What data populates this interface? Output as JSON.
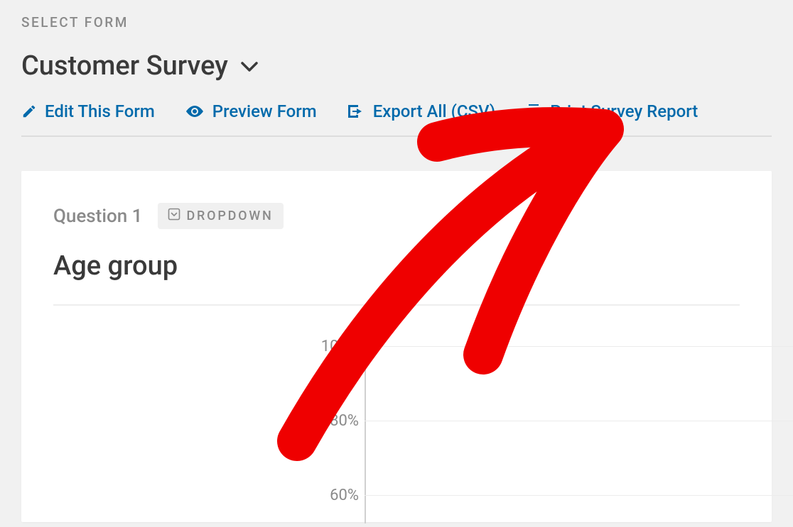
{
  "header": {
    "select_form_label": "SELECT FORM",
    "form_title": "Customer Survey"
  },
  "actions": {
    "edit_form": "Edit This Form",
    "preview_form": "Preview Form",
    "export_csv": "Export All (CSV)",
    "print_report": "Print Survey Report"
  },
  "question": {
    "label": "Question 1",
    "badge": "DROPDOWN",
    "title": "Age group"
  },
  "chart_data": {
    "type": "bar",
    "title": "",
    "xlabel": "",
    "ylabel": "",
    "ylim": [
      0,
      100
    ],
    "y_ticks": [
      "100%",
      "80%",
      "60%"
    ],
    "categories": [],
    "values": []
  }
}
